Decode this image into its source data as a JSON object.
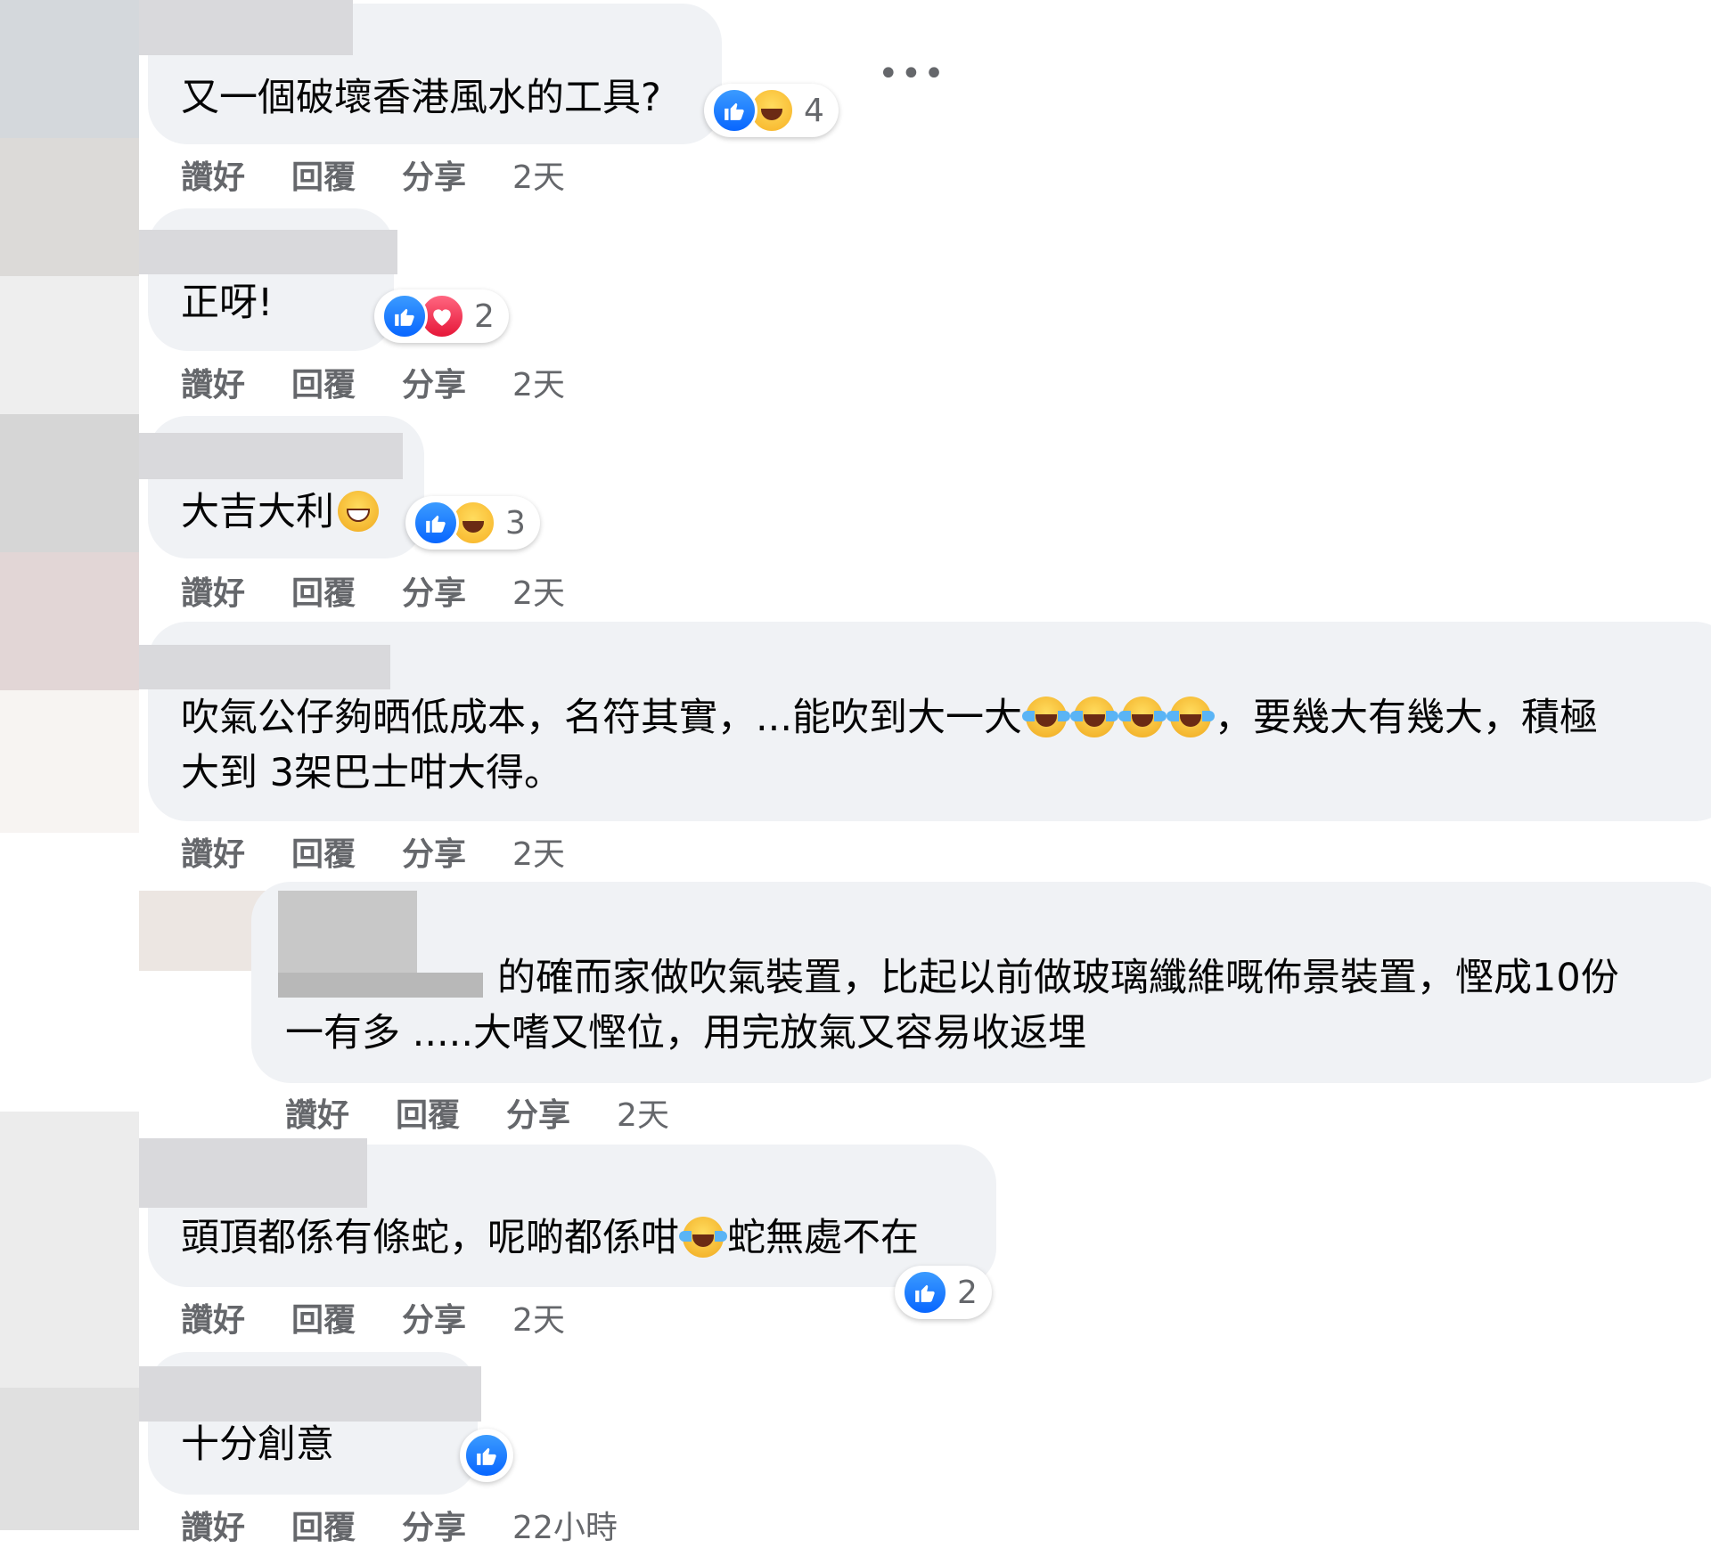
{
  "actions": {
    "like": "讚好",
    "reply": "回覆",
    "share": "分享"
  },
  "more_label": "•••",
  "comments": [
    {
      "text": "又一個破壞香港風水的工具?",
      "reactions": [
        "like",
        "haha"
      ],
      "count": "4",
      "time": "2天"
    },
    {
      "text": "正呀!",
      "reactions": [
        "like",
        "love"
      ],
      "count": "2",
      "time": "2天"
    },
    {
      "text": "大吉大利",
      "reactions": [
        "like",
        "haha"
      ],
      "count": "3",
      "time": "2天"
    },
    {
      "text_a": "吹氣公仔夠晒低成本，名符其實，...能吹到大一大",
      "text_b": "，要幾大有幾大，積極",
      "text_line2": "大到 3架巴士咁大得。",
      "time": "2天"
    },
    {
      "text_line1": "的確而家做吹氣裝置，比起以前做玻璃纖維嘅佈景裝置，慳成10份",
      "text_line2": "一有多 .....大嗜又慳位，用完放氣又容易收返埋",
      "time": "2天"
    },
    {
      "text_a": "頭頂都係有條蛇，呢啲都係咁",
      "text_b": "蛇無處不在",
      "reactions": [
        "like"
      ],
      "count": "2",
      "time": "2天"
    },
    {
      "text": "十分創意",
      "reactions": [
        "like"
      ],
      "time": "22小時"
    }
  ],
  "colors": {
    "bubble": "#f0f2f5",
    "meta": "#65676b",
    "like": "#0866ff"
  }
}
